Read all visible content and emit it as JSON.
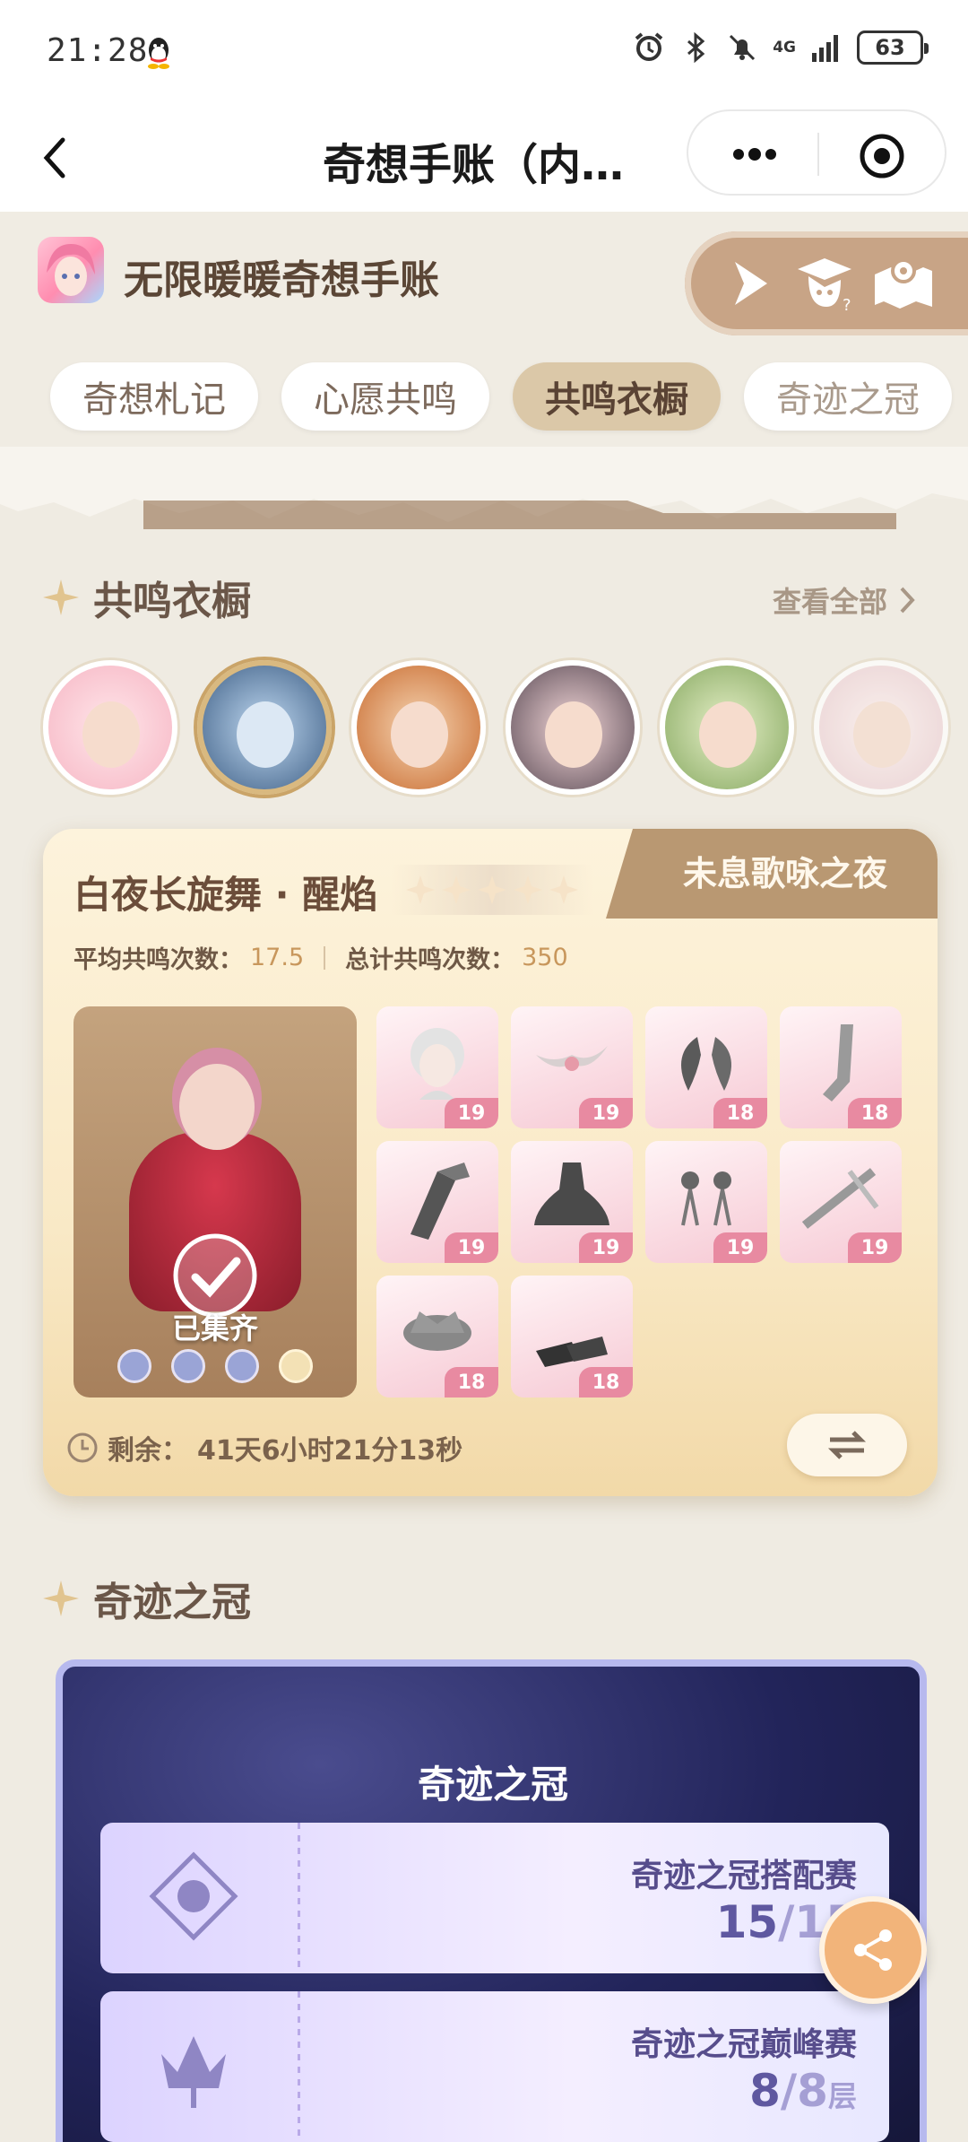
{
  "status_bar": {
    "time": "21:28",
    "network": "4G",
    "battery": "63"
  },
  "nav": {
    "title": "奇想手账（内…"
  },
  "app": {
    "name": "无限暖暖奇想手账"
  },
  "tabs": [
    {
      "label": "奇想札记",
      "active": false
    },
    {
      "label": "心愿共鸣",
      "active": false
    },
    {
      "label": "共鸣衣橱",
      "active": true
    },
    {
      "label": "奇迹之冠",
      "active": false
    }
  ],
  "wardrobe": {
    "section_title": "共鸣衣橱",
    "view_all": "查看全部",
    "card": {
      "title": "白夜长旋舞 · 醒焰",
      "stars": 5,
      "ribbon": "未息歌咏之夜",
      "avg_label": "平均共鸣次数：",
      "avg_value": "17.5",
      "total_label": "总计共鸣次数：",
      "total_value": "350",
      "collected_label": "已集齐",
      "remaining_label": "剩余：",
      "remaining_value": "41天6小时21分13秒",
      "items": [
        {
          "icon": "hair-icon",
          "count": "19"
        },
        {
          "icon": "headpiece-icon",
          "count": "19"
        },
        {
          "icon": "wings-icon",
          "count": "18"
        },
        {
          "icon": "socks-icon",
          "count": "18"
        },
        {
          "icon": "gloves-icon",
          "count": "19"
        },
        {
          "icon": "dress-icon",
          "count": "19"
        },
        {
          "icon": "earrings-icon",
          "count": "19"
        },
        {
          "icon": "handheld-icon",
          "count": "19"
        },
        {
          "icon": "crown-icon",
          "count": "18"
        },
        {
          "icon": "shoes-icon",
          "count": "18"
        }
      ]
    }
  },
  "crown": {
    "section_title": "奇迹之冠",
    "card_title": "奇迹之冠",
    "rows": [
      {
        "name": "奇迹之冠搭配赛",
        "value": "15",
        "total": "/15",
        "unit": ""
      },
      {
        "name": "奇迹之冠巅峰赛",
        "value": "8",
        "total": "/8",
        "unit": "层"
      }
    ]
  },
  "colors": {
    "accent": "#b99872",
    "badge": "#e88aa1",
    "crown_bg": "#22245a",
    "fab": "#f2b47a"
  }
}
